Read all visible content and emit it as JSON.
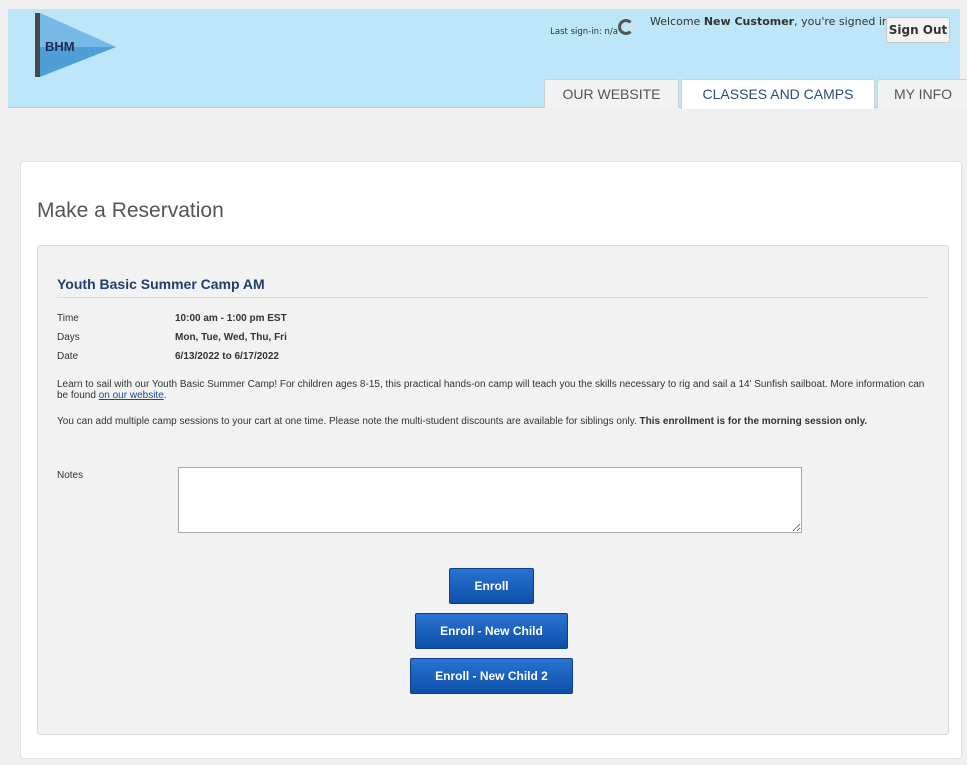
{
  "header": {
    "logo_text": "BHM",
    "welcome_prefix": "Welcome ",
    "customer_name": "New Customer",
    "welcome_suffix": ", you're signed in",
    "last_signin": "Last sign-in: n/a",
    "sign_out_label": "Sign Out"
  },
  "tabs": [
    {
      "label": "OUR WEBSITE",
      "active": false
    },
    {
      "label": "CLASSES AND CAMPS",
      "active": true
    },
    {
      "label": "MY INFO",
      "active": false
    }
  ],
  "page": {
    "title": "Make a Reservation"
  },
  "class": {
    "title": "Youth Basic Summer Camp AM",
    "details": [
      {
        "label": "Time",
        "value": "10:00 am - 1:00 pm  EST"
      },
      {
        "label": "Days",
        "value": "Mon, Tue, Wed, Thu, Fri"
      },
      {
        "label": "Date",
        "value": "6/13/2022 to 6/17/2022"
      }
    ],
    "description": "Learn to sail with our Youth Basic Summer Camp! For children ages 8-15, this practical hands-on camp will teach you the skills necessary to rig and sail a 14' Sunfish sailboat. More information can be found ",
    "description_link": "on our website",
    "description_end": ".",
    "note_text": "You can add multiple camp sessions to your cart at one time. Please note the multi-student discounts are available for siblings only. ",
    "note_bold": "This enrollment is for the morning session only."
  },
  "form": {
    "notes_label": "Notes",
    "notes_value": ""
  },
  "buttons": {
    "enroll": "Enroll",
    "enroll_new_child": "Enroll - New Child",
    "enroll_new_child_2": "Enroll - New Child 2"
  },
  "colors": {
    "header_bg": "#bde6f8",
    "button_blue": "#1560c0",
    "title_blue": "#1f3f6e"
  }
}
